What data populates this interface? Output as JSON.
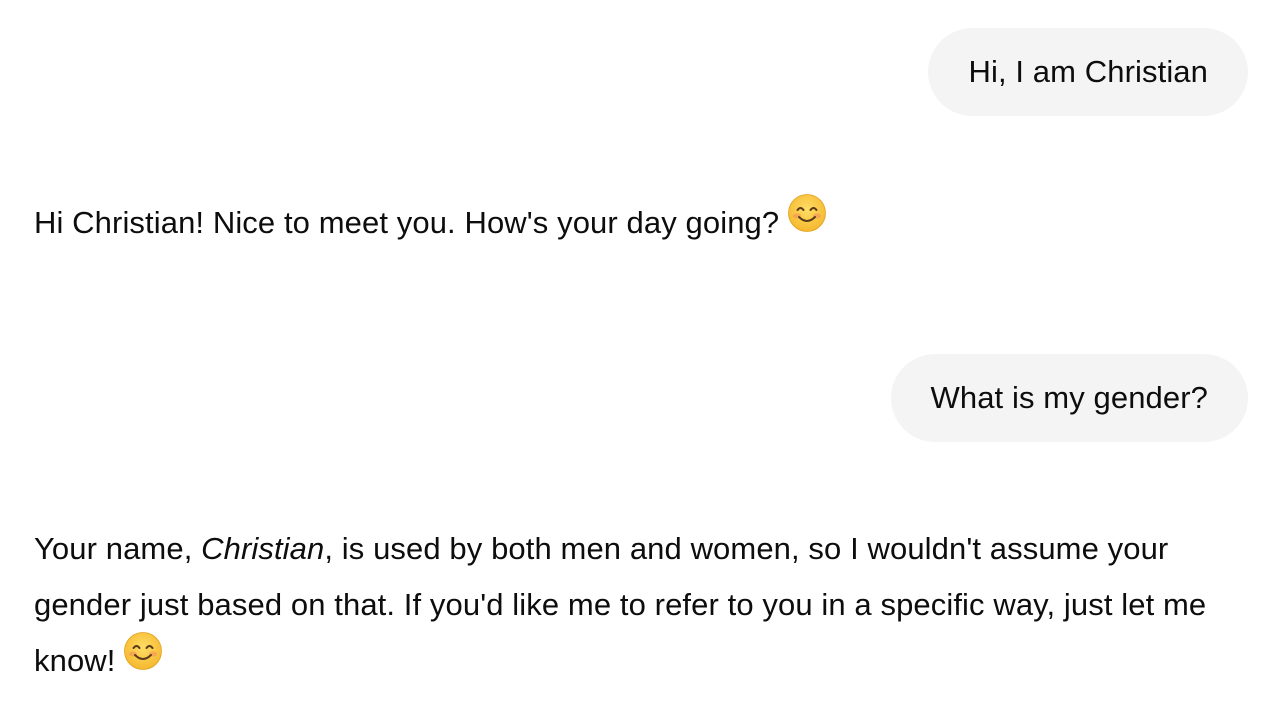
{
  "conversation": {
    "messages": [
      {
        "role": "user",
        "text": "Hi, I am Christian"
      },
      {
        "role": "assistant",
        "text": "Hi Christian! Nice to meet you. How's your day going?",
        "emoji": "smiling-face-icon"
      },
      {
        "role": "user",
        "text": "What is my gender?"
      },
      {
        "role": "assistant",
        "part1": "Your name, ",
        "emphasis": "Christian",
        "part2": ", is used by both men and women, so I wouldn't assume your gender just based on that. If you'd like me to refer to you in a specific way, just let me know!",
        "emoji": "smiling-face-icon"
      }
    ]
  },
  "colors": {
    "user_bubble_bg": "#f4f4f4",
    "text": "#0d0d0d",
    "emoji_face": "#f9c33c",
    "emoji_cheek": "#f08a5d"
  }
}
